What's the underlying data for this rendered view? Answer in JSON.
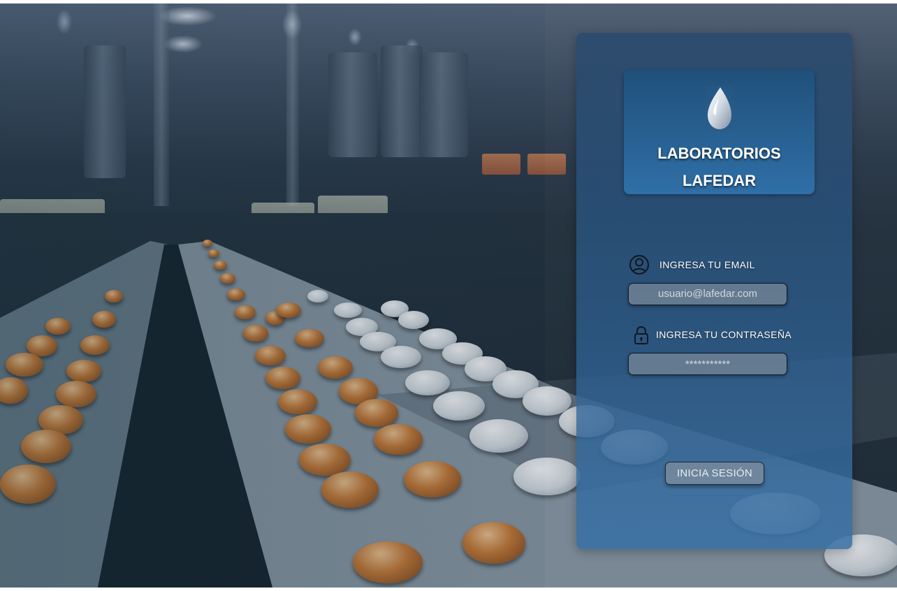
{
  "brand": {
    "name_line1": "LABORATORIOS",
    "name_line2": "LAFEDAR",
    "logo_icon": "droplet-icon"
  },
  "login": {
    "email_label": "INGRESA TU EMAIL",
    "email_placeholder": "usuario@lafedar.com",
    "email_icon": "user-circle-icon",
    "password_label": "INGRESA TU CONTRASEÑA",
    "password_value": "***********",
    "password_icon": "lock-icon",
    "submit_label": "INICIA SESIÓN"
  },
  "background": {
    "subject": "pharmaceutical production line",
    "icon": "background-photo"
  },
  "colors": {
    "card": "#2c5c8c",
    "brand_box": "#2a6194",
    "input": "#70829a",
    "text": "#ffffff"
  }
}
